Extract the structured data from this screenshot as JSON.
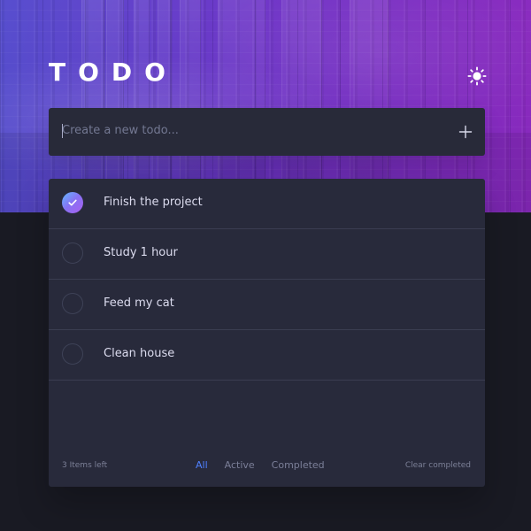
{
  "header": {
    "title": "TODO",
    "theme_icon": "sun-icon"
  },
  "new_todo": {
    "placeholder": "Create a new todo...",
    "value": "",
    "add_icon": "plus-icon"
  },
  "todos": [
    {
      "label": "Finish the project",
      "completed": true
    },
    {
      "label": "Study 1 hour",
      "completed": false
    },
    {
      "label": "Feed my cat",
      "completed": false
    },
    {
      "label": "Clean house",
      "completed": false
    }
  ],
  "footer": {
    "items_left": "3 Items left",
    "filters": {
      "all": "All",
      "active": "Active",
      "completed": "Completed",
      "selected": "All"
    },
    "clear_completed": "Clear completed"
  },
  "colors": {
    "accent": "#4f80ff",
    "check_gradient_start": "#62b9ff",
    "check_gradient_end": "#a95ff0",
    "card": "#282a3b",
    "background": "#191a23"
  }
}
